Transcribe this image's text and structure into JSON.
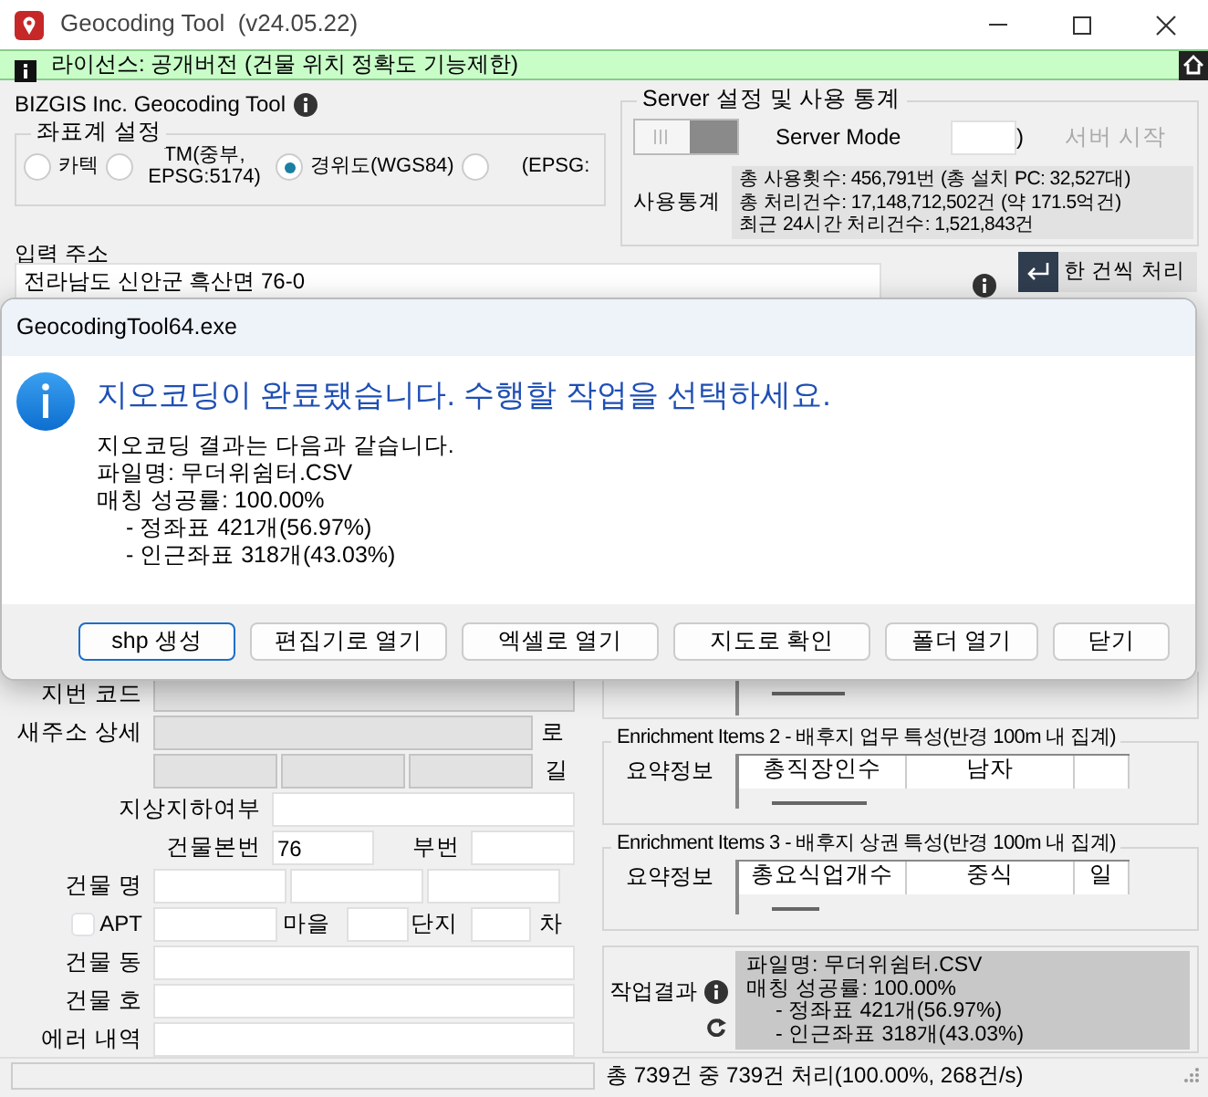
{
  "window": {
    "title": "Geocoding Tool  (v24.05.22)"
  },
  "license_bar": {
    "text": "라이선스: 공개버전 (건물 위치 정확도 기능제한)"
  },
  "app_title": "BIZGIS Inc. Geocoding Tool",
  "coordinate_system": {
    "legend": "좌표계 설정",
    "options": [
      {
        "label": "카텍",
        "selected": false
      },
      {
        "label": "TM(중부, EPSG:5174)",
        "selected": false
      },
      {
        "label": "경위도(WGS84)",
        "selected": true
      },
      {
        "label": "(EPSG:",
        "selected": false
      }
    ]
  },
  "server": {
    "legend": "Server 설정 및 사용 통계",
    "mode_toggle": {
      "on": false
    },
    "mode_label": "Server Mode",
    "port_suffix": ")",
    "start_button": {
      "label": "서버 시작",
      "disabled": true
    },
    "stats_label": "사용통계",
    "stats": [
      "총 사용횟수: 456,791번 (총 설치 PC: 32,527대)",
      "총 처리건수: 17,148,712,502건 (약 171.5억건)",
      "최근 24시간 처리건수: 1,521,843건"
    ]
  },
  "input": {
    "label": "입력 주소",
    "value": "전라남도 신안군 흑산면 76-0"
  },
  "process_button": {
    "label": "한 건씩 처리"
  },
  "dialog": {
    "title": "GeocodingTool64.exe",
    "heading": "지오코딩이 완료됐습니다. 수행할 작업을 선택하세요.",
    "lines": [
      {
        "text": "지오코딩 결과는 다음과 같습니다.",
        "indent": false
      },
      {
        "text": "파일명: 무더위쉼터.CSV",
        "indent": false
      },
      {
        "text": "매칭 성공률: 100.00%",
        "indent": false
      },
      {
        "text": "- 정좌표 421개(56.97%)",
        "indent": true
      },
      {
        "text": "- 인근좌표 318개(43.03%)",
        "indent": true
      }
    ],
    "buttons": [
      {
        "label": "shp 생성",
        "focused": true
      },
      {
        "label": "편집기로 열기",
        "focused": false
      },
      {
        "label": "엑셀로 열기",
        "focused": false
      },
      {
        "label": "지도로 확인",
        "focused": false
      },
      {
        "label": "폴더 열기",
        "focused": false
      },
      {
        "label": "닫기",
        "focused": false
      }
    ]
  },
  "form_rows": [
    {
      "kind": "single",
      "label": "지번 코드",
      "disabled": true
    },
    {
      "kind": "single",
      "label": "새주소 상세",
      "disabled": true,
      "suffix": "로"
    },
    {
      "kind": "triple",
      "disabled": true,
      "suffix": "길"
    },
    {
      "kind": "indented",
      "label": "지상지하여부"
    },
    {
      "kind": "pair",
      "label": "건물본번",
      "value": "76",
      "label_2": "부번"
    },
    {
      "kind": "triple",
      "label": "건물 명"
    },
    {
      "kind": "apt",
      "checkbox": {
        "label": "APT",
        "checked": false
      },
      "label_2": "마을",
      "label_3": "단지",
      "suffix": "차"
    },
    {
      "kind": "single",
      "label": "건물 동"
    },
    {
      "kind": "single",
      "label": "건물 호"
    },
    {
      "kind": "single",
      "label": "에러 내역"
    }
  ],
  "enrichment": [
    {
      "legend": "Enrichment Items 2 - 배후지 업무 특성(반경 100m 내 집계)",
      "label": "요약정보",
      "columns": [
        "총직장인수",
        "남자"
      ]
    },
    {
      "legend": "Enrichment Items 3 - 배후지 상권 특성(반경 100m 내 집계)",
      "label": "요약정보",
      "columns": [
        "총요식업개수",
        "중식",
        "일"
      ]
    }
  ],
  "result": {
    "label": "작업결과",
    "lines": [
      {
        "text": "파일명: 무더위쉼터.CSV",
        "indent": false
      },
      {
        "text": "매칭 성공률: 100.00%",
        "indent": false
      },
      {
        "text": "- 정좌표 421개(56.97%)",
        "indent": true
      },
      {
        "text": "- 인근좌표 318개(43.03%)",
        "indent": true
      }
    ]
  },
  "status_bar": {
    "text": "총 739건 중 739건 처리(100.00%, 268건/s)"
  }
}
